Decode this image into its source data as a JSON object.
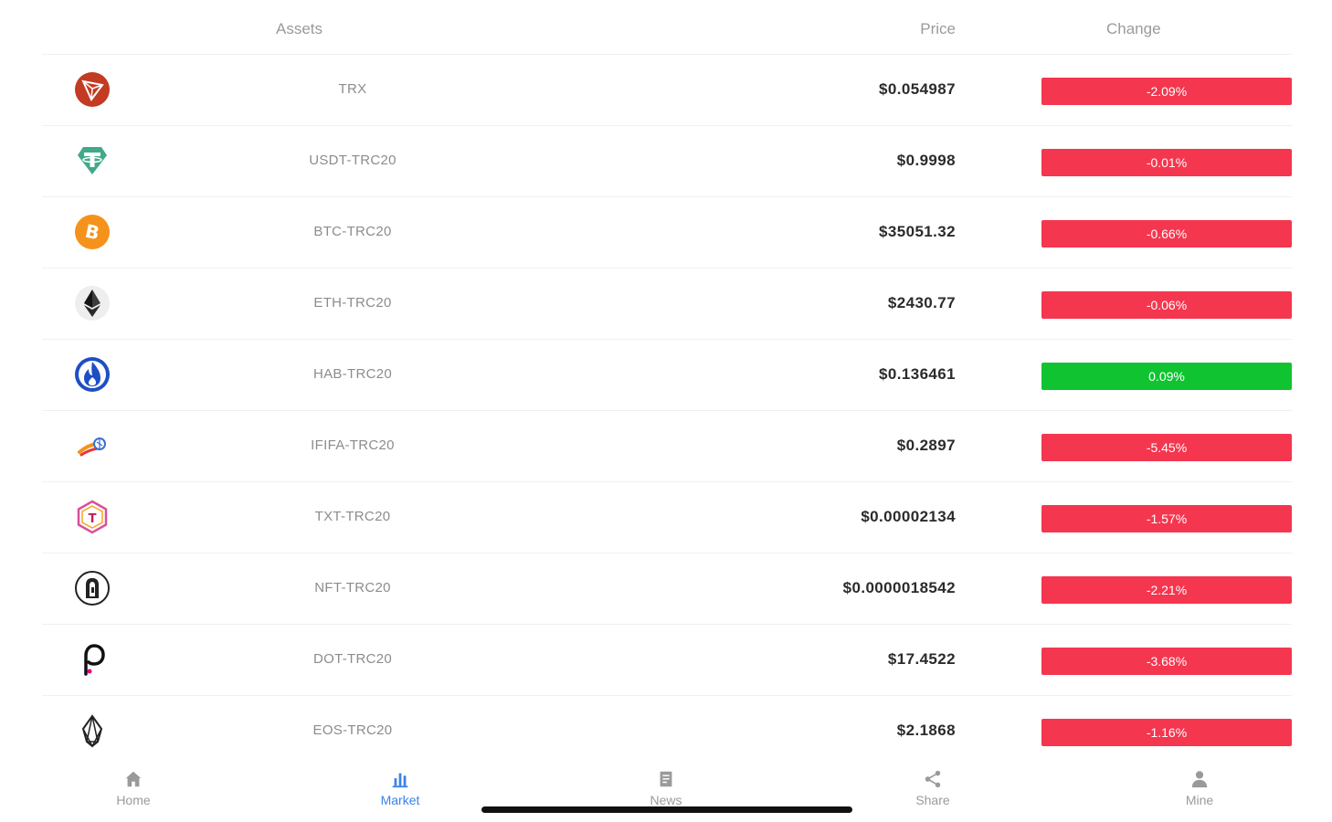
{
  "table": {
    "headers": {
      "assets": "Assets",
      "price": "Price",
      "change": "Change"
    },
    "rows": [
      {
        "icon": "trx-icon",
        "name": "TRX",
        "price": "$0.054987",
        "change": "-2.09%",
        "direction": "down"
      },
      {
        "icon": "usdt-icon",
        "name": "USDT-TRC20",
        "price": "$0.9998",
        "change": "-0.01%",
        "direction": "down"
      },
      {
        "icon": "btc-icon",
        "name": "BTC-TRC20",
        "price": "$35051.32",
        "change": "-0.66%",
        "direction": "down"
      },
      {
        "icon": "eth-icon",
        "name": "ETH-TRC20",
        "price": "$2430.77",
        "change": "-0.06%",
        "direction": "down"
      },
      {
        "icon": "hab-icon",
        "name": "HAB-TRC20",
        "price": "$0.136461",
        "change": "0.09%",
        "direction": "up"
      },
      {
        "icon": "ififa-icon",
        "name": "IFIFA-TRC20",
        "price": "$0.2897",
        "change": "-5.45%",
        "direction": "down"
      },
      {
        "icon": "txt-icon",
        "name": "TXT-TRC20",
        "price": "$0.00002134",
        "change": "-1.57%",
        "direction": "down"
      },
      {
        "icon": "nft-icon",
        "name": "NFT-TRC20",
        "price": "$0.0000018542",
        "change": "-2.21%",
        "direction": "down"
      },
      {
        "icon": "dot-icon",
        "name": "DOT-TRC20",
        "price": "$17.4522",
        "change": "-3.68%",
        "direction": "down"
      },
      {
        "icon": "eos-icon",
        "name": "EOS-TRC20",
        "price": "$2.1868",
        "change": "-1.16%",
        "direction": "down"
      }
    ]
  },
  "tabbar": {
    "items": [
      {
        "label": "Home",
        "icon": "home-icon",
        "active": false
      },
      {
        "label": "Market",
        "icon": "market-icon",
        "active": true
      },
      {
        "label": "News",
        "icon": "news-icon",
        "active": false
      },
      {
        "label": "Share",
        "icon": "share-icon",
        "active": false
      },
      {
        "label": "Mine",
        "icon": "mine-icon",
        "active": false
      }
    ]
  },
  "colors": {
    "negative": "#f5364f",
    "positive": "#10c431",
    "active_tab": "#3b82e6",
    "inactive_tab": "#9a9a9a"
  }
}
